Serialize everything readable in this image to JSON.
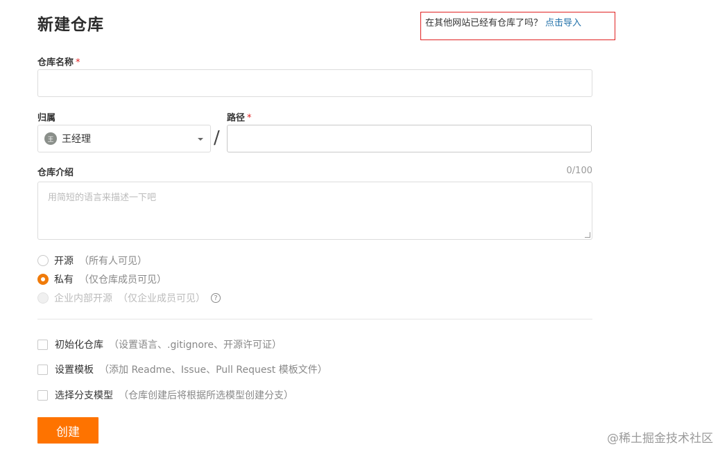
{
  "page": {
    "title": "新建仓库"
  },
  "import": {
    "prompt": "在其他网站已经有仓库了吗？",
    "link": "点击导入"
  },
  "form": {
    "repo_name": {
      "label": "仓库名称",
      "required_mark": "*",
      "value": ""
    },
    "owner": {
      "label": "归属",
      "avatar_text": "王",
      "selected": "王经理"
    },
    "separator": "/",
    "path": {
      "label": "路径",
      "required_mark": "*",
      "value": ""
    },
    "description": {
      "label": "仓库介绍",
      "counter": "0/100",
      "placeholder": "用简短的语言来描述一下吧"
    },
    "visibility": [
      {
        "label": "开源",
        "hint": "（所有人可见）",
        "checked": false,
        "disabled": false
      },
      {
        "label": "私有",
        "hint": "（仅仓库成员可见）",
        "checked": true,
        "disabled": false
      },
      {
        "label": "企业内部开源",
        "hint": "（仅企业成员可见）",
        "checked": false,
        "disabled": true
      }
    ],
    "help_icon": "?",
    "options": [
      {
        "label": "初始化仓库",
        "hint": "（设置语言、.gitignore、开源许可证）"
      },
      {
        "label": "设置模板",
        "hint": "（添加 Readme、Issue、Pull Request 模板文件）"
      },
      {
        "label": "选择分支模型",
        "hint": "（仓库创建后将根据所选模型创建分支）"
      }
    ],
    "submit_label": "创建"
  },
  "watermark": "@稀土掘金技术社区",
  "colors": {
    "accent": "#fe7300",
    "required": "#e02020",
    "link": "#1f6fa8",
    "import_border": "#e02020"
  }
}
